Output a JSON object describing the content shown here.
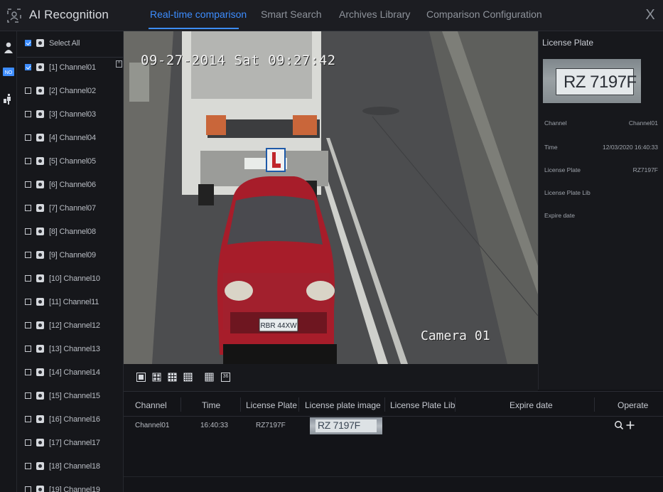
{
  "app": {
    "title": "AI Recognition"
  },
  "tabs": [
    {
      "label": "Real-time comparison",
      "active": true
    },
    {
      "label": "Smart Search",
      "active": false
    },
    {
      "label": "Archives Library",
      "active": false
    },
    {
      "label": "Comparison Configuration",
      "active": false
    }
  ],
  "close_label": "X",
  "channels": {
    "select_all": "Select All",
    "items": [
      {
        "label": "[1] Channel01",
        "checked": true
      },
      {
        "label": "[2] Channel02",
        "checked": false
      },
      {
        "label": "[3] Channel03",
        "checked": false
      },
      {
        "label": "[4] Channel04",
        "checked": false
      },
      {
        "label": "[5] Channel05",
        "checked": false
      },
      {
        "label": "[6] Channel06",
        "checked": false
      },
      {
        "label": "[7] Channel07",
        "checked": false
      },
      {
        "label": "[8] Channel08",
        "checked": false
      },
      {
        "label": "[9] Channel09",
        "checked": false
      },
      {
        "label": "[10] Channel10",
        "checked": false
      },
      {
        "label": "[11] Channel11",
        "checked": false
      },
      {
        "label": "[12] Channel12",
        "checked": false
      },
      {
        "label": "[13] Channel13",
        "checked": false
      },
      {
        "label": "[14] Channel14",
        "checked": false
      },
      {
        "label": "[15] Channel15",
        "checked": false
      },
      {
        "label": "[16] Channel16",
        "checked": false
      },
      {
        "label": "[17] Channel17",
        "checked": false
      },
      {
        "label": "[18] Channel18",
        "checked": false
      },
      {
        "label": "[19] Channel19",
        "checked": false
      }
    ]
  },
  "video": {
    "osd_timestamp": "09-27-2014 Sat 09:27:42",
    "osd_camera": "Camera 01",
    "front_plate": "RBR 44XW"
  },
  "info_panel": {
    "title": "License Plate",
    "plate_text": "RZ 7197F",
    "rows": [
      {
        "key": "Channel",
        "value": "Channel01"
      },
      {
        "key": "Time",
        "value": "12/03/2020 16:40:33"
      },
      {
        "key": "License Plate",
        "value": "RZ7197F"
      },
      {
        "key": "License Plate Lib",
        "value": ""
      },
      {
        "key": "Expire date",
        "value": ""
      }
    ]
  },
  "layout_buttons": [
    "1",
    "4",
    "9",
    "16",
    "25",
    "36"
  ],
  "table": {
    "headers": {
      "channel": "Channel",
      "time": "Time",
      "plate": "License Plate",
      "plate_image": "License plate image",
      "plate_lib": "License Plate Lib",
      "expire": "Expire date",
      "operate": "Operate"
    },
    "rows": [
      {
        "channel": "Channel01",
        "time": "16:40:33",
        "plate": "RZ7197F",
        "plate_image_text": "RZ 7197F",
        "plate_lib": "",
        "expire": ""
      }
    ]
  },
  "colors": {
    "accent": "#3d8dff",
    "background": "#111216",
    "panel": "#17181c"
  }
}
